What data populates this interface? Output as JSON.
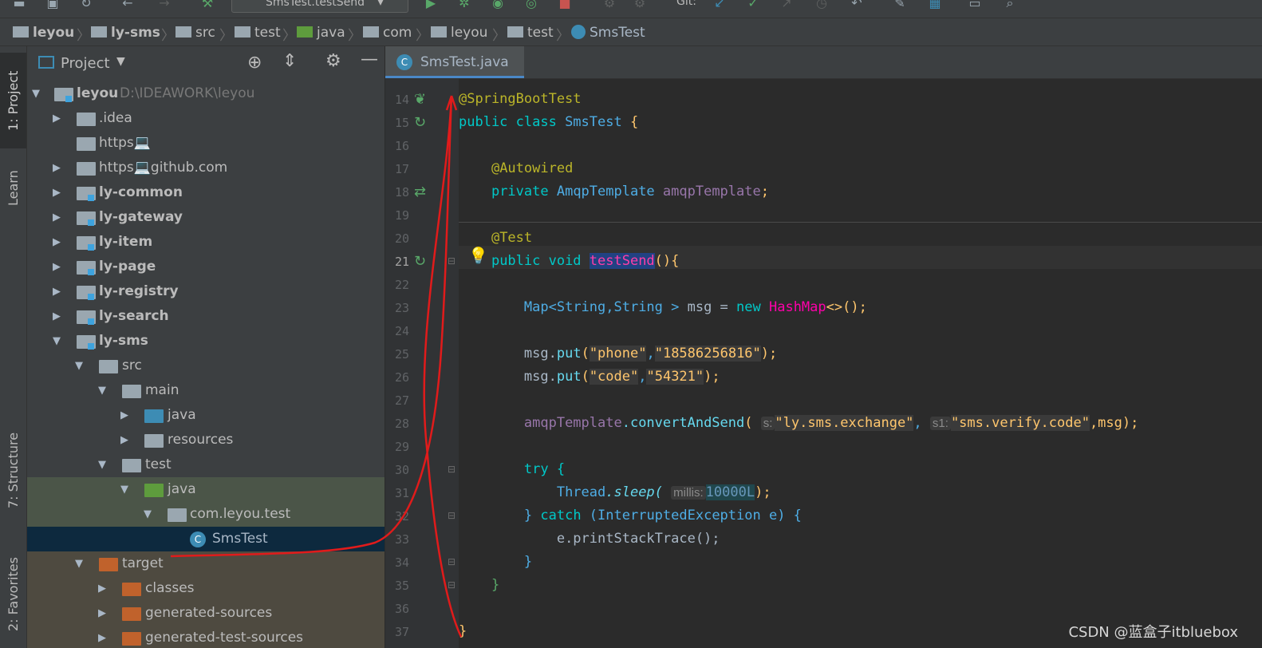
{
  "toolbar": {
    "run_config": "SmsTest.testSend",
    "git_label": "Git:"
  },
  "breadcrumb": [
    {
      "label": "leyou",
      "bold": true
    },
    {
      "label": "ly-sms",
      "bold": true
    },
    {
      "label": "src"
    },
    {
      "label": "test"
    },
    {
      "label": "java"
    },
    {
      "label": "com"
    },
    {
      "label": "leyou"
    },
    {
      "label": "test"
    },
    {
      "label": "SmsTest"
    }
  ],
  "left_tabs": {
    "project": "1: Project",
    "learn": "Learn",
    "structure": "7: Structure",
    "favorites": "2: Favorites"
  },
  "project_panel": {
    "title": "Project"
  },
  "tree": [
    {
      "label": "leyou",
      "path": "D:\\IDEAWORK\\leyou",
      "bold": true
    },
    {
      "label": ".idea"
    },
    {
      "label": "https💻"
    },
    {
      "label": "https💻github.com"
    },
    {
      "label": "ly-common",
      "bold": true
    },
    {
      "label": "ly-gateway",
      "bold": true
    },
    {
      "label": "ly-item",
      "bold": true
    },
    {
      "label": "ly-page",
      "bold": true
    },
    {
      "label": "ly-registry",
      "bold": true
    },
    {
      "label": "ly-search",
      "bold": true
    },
    {
      "label": "ly-sms",
      "bold": true
    },
    {
      "label": "src"
    },
    {
      "label": "main"
    },
    {
      "label": "java"
    },
    {
      "label": "resources"
    },
    {
      "label": "test"
    },
    {
      "label": "java"
    },
    {
      "label": "com.leyou.test"
    },
    {
      "label": "SmsTest"
    },
    {
      "label": "target"
    },
    {
      "label": "classes"
    },
    {
      "label": "generated-sources"
    },
    {
      "label": "generated-test-sources"
    }
  ],
  "editor": {
    "tab_label": "SmsTest.java",
    "line_numbers": [
      "14",
      "15",
      "16",
      "17",
      "18",
      "19",
      "20",
      "21",
      "22",
      "23",
      "24",
      "25",
      "26",
      "27",
      "28",
      "29",
      "30",
      "31",
      "32",
      "33",
      "34",
      "35",
      "36",
      "37"
    ],
    "code": {
      "l14": "@SpringBootTest",
      "l15_kw": "public class ",
      "l15_cls": "SmsTest",
      "l15_brace": " {",
      "l17": "@Autowired",
      "l18_kw": "private ",
      "l18_ty": "AmqpTemplate ",
      "l18_fld": "amqpTemplate",
      "l18_end": ";",
      "l20": "@Test",
      "l21_kw": "public void ",
      "l21_m": "testSend",
      "l21_end": "(){",
      "l23_a": "Map",
      "l23_b": "<String,String > ",
      "l23_c": "msg = ",
      "l23_kw": "new ",
      "l23_hm": "HashMap",
      "l23_end": "<>();",
      "l25_a": "msg.",
      "l25_m": "put",
      "l25_s1": "\"phone\"",
      "l25_s2": "\"18586256816\"",
      "l26_a": "msg.",
      "l26_m": "put",
      "l26_s1": "\"code\"",
      "l26_s2": "\"54321\"",
      "l28_a": "amqpTemplate",
      "l28_m": ".convertAndSend",
      "l28_h1": "s:",
      "l28_s1": "\"ly.sms.exchange\"",
      "l28_h2": "s1:",
      "l28_s2": "\"sms.verify.code\"",
      "l28_end": ",msg);",
      "l30": "try {",
      "l31_a": "Thread",
      "l31_m": ".sleep(",
      "l31_h": "millis:",
      "l31_n": "10000L",
      "l31_end": ");",
      "l32_a": "} ",
      "l32_kw": "catch ",
      "l32_ty": "(InterruptedException ",
      "l32_e": "e) {",
      "l33": "e.printStackTrace();",
      "l34": "}",
      "l35": "}",
      "l37": "}"
    }
  },
  "watermark": "CSDN @蓝盒子itbluebox",
  "colors": {
    "annotation_red": "#e01b1b",
    "selection": "#0d293e",
    "accent": "#4a88c7"
  }
}
